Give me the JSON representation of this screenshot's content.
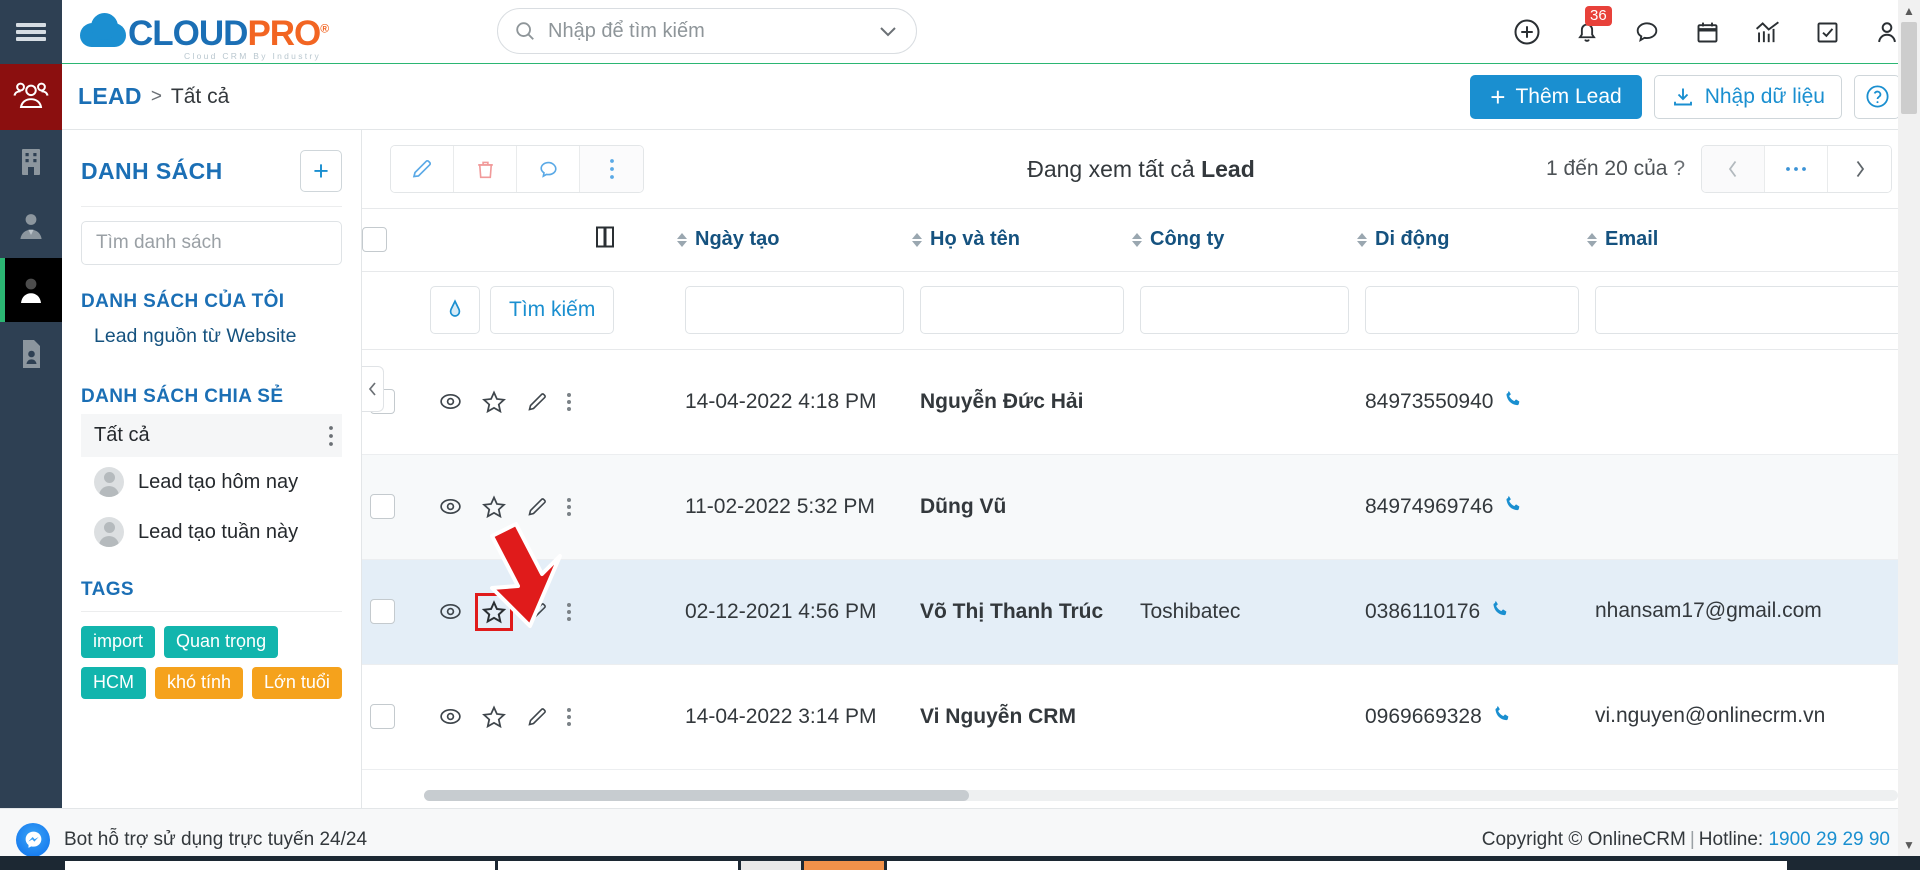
{
  "topbar": {
    "menu_icon": "hamburger-icon",
    "logo": {
      "part1": "CLOUD",
      "part2": "PRO",
      "registered": "®",
      "tagline": "Cloud CRM By Industry"
    },
    "search": {
      "placeholder": "Nhập để tìm kiếm",
      "value": "",
      "icon": "search-icon",
      "chevron": "chevron-down-icon"
    },
    "icons": [
      {
        "name": "add-circle-icon",
        "label": ""
      },
      {
        "name": "bell-icon",
        "label": "",
        "badge": "36"
      },
      {
        "name": "chat-bubble-icon",
        "label": ""
      },
      {
        "name": "calendar-icon",
        "label": ""
      },
      {
        "name": "analytics-icon",
        "label": ""
      },
      {
        "name": "task-check-icon",
        "label": ""
      },
      {
        "name": "user-account-icon",
        "label": ""
      }
    ],
    "notification_badge": "36"
  },
  "subbar": {
    "breadcrumb": {
      "root": "LEAD",
      "separator": ">",
      "current": "Tất cả"
    },
    "add_lead_label": "Thêm Lead",
    "add_lead_plus": "+",
    "import_label": "Nhập dữ liệu",
    "help_label": "?"
  },
  "rail": {
    "items": [
      {
        "name": "sidebar-item-contacts-group",
        "icon": "people-group-icon",
        "state": "active-red"
      },
      {
        "name": "sidebar-item-company",
        "icon": "building-icon",
        "state": "normal"
      },
      {
        "name": "sidebar-item-contact-person",
        "icon": "person-tie-icon",
        "state": "normal"
      },
      {
        "name": "sidebar-item-lead",
        "icon": "person-icon",
        "state": "active-black"
      },
      {
        "name": "sidebar-item-document",
        "icon": "document-person-icon",
        "state": "normal"
      }
    ]
  },
  "list_panel": {
    "title": "DANH SÁCH",
    "add_button": "+",
    "search_placeholder": "Tìm danh sách",
    "search_value": "",
    "my_lists_header": "DANH SÁCH CỦA TÔI",
    "my_lists": [
      "Lead nguồn từ Website"
    ],
    "shared_header": "DANH SÁCH CHIA SẺ",
    "shared_selected": "Tất cả",
    "shared_items": [
      {
        "label": "Lead tạo hôm nay",
        "icon": "avatar-icon"
      },
      {
        "label": "Lead tạo tuần này",
        "icon": "avatar-icon"
      }
    ],
    "tags_header": "TAGS",
    "tags": [
      {
        "label": "import",
        "color": "#12b5ad"
      },
      {
        "label": "Quan trọng",
        "color": "#12b5ad"
      },
      {
        "label": "HCM",
        "color": "#12b5ad"
      },
      {
        "label": "khó tính",
        "color": "#f5a21c"
      },
      {
        "label": "Lớn tuổi",
        "color": "#f5a21c"
      }
    ],
    "collapse_icon": "chevron-left-icon"
  },
  "main": {
    "toolbar": [
      {
        "name": "edit-button",
        "icon": "pencil-icon",
        "color": "#5aa9e6"
      },
      {
        "name": "delete-button",
        "icon": "trash-icon",
        "color": "#f19a9a"
      },
      {
        "name": "comment-button",
        "icon": "comment-icon",
        "color": "#5aa9e6"
      },
      {
        "name": "more-actions-button",
        "icon": "kebab-menu-icon",
        "color": "#5aa9e6"
      }
    ],
    "view_title_prefix": "Đang xem tất cả ",
    "view_title_strong": "Lead",
    "pagination": {
      "text": "1 đến 20 của",
      "total": "?",
      "prev_icon": "chevron-left-icon",
      "more_icon": "ellipsis-icon",
      "next_icon": "chevron-right-icon"
    },
    "columns": [
      {
        "key": "checkbox",
        "label": "",
        "sortable": false
      },
      {
        "key": "actions",
        "label": "",
        "sortable": false
      },
      {
        "key": "layout",
        "label": "",
        "icon": "column-layout-icon",
        "sortable": false
      },
      {
        "key": "created",
        "label": "Ngày tạo",
        "sortable": true
      },
      {
        "key": "name",
        "label": "Họ và tên",
        "sortable": true
      },
      {
        "key": "company",
        "label": "Công ty",
        "sortable": true
      },
      {
        "key": "mobile",
        "label": "Di động",
        "sortable": true
      },
      {
        "key": "email",
        "label": "Email",
        "sortable": true
      }
    ],
    "filter_row": {
      "erase_icon": "eraser-icon",
      "search_button": "Tìm kiếm",
      "inputs": [
        "",
        "",
        "",
        "",
        ""
      ]
    },
    "rows": [
      {
        "created": "14-04-2022 4:18 PM",
        "name": "Nguyễn Đức Hải",
        "company": "",
        "mobile": "84973550940",
        "email": "",
        "starred": false,
        "highlight": false
      },
      {
        "created": "11-02-2022 5:32 PM",
        "name": "Dũng Vũ",
        "company": "",
        "mobile": "84974969746",
        "email": "",
        "starred": false,
        "highlight": false
      },
      {
        "created": "02-12-2021 4:56 PM",
        "name": "Võ Thị Thanh Trúc",
        "company": "Toshibatec",
        "mobile": "0386110176",
        "email": "nhansam17@gmail.com",
        "starred": false,
        "highlight": true
      },
      {
        "created": "14-04-2022 3:14 PM",
        "name": "Vi Nguyễn CRM",
        "company": "",
        "mobile": "0969669328",
        "email": "vi.nguyen@onlinecrm.vn",
        "starred": false,
        "highlight": false
      }
    ],
    "row_icons": [
      {
        "name": "view-icon"
      },
      {
        "name": "star-icon"
      },
      {
        "name": "edit-icon"
      },
      {
        "name": "row-menu-icon"
      }
    ]
  },
  "footer": {
    "bot_text": "Bot hỗ trợ sử dụng trực tuyến 24/24",
    "bot_icon": "messenger-icon",
    "copyright": "Copyright © OnlineCRM",
    "separator": "|",
    "hotline_label": "Hotline:",
    "hotline_number": "1900 29 29 90"
  },
  "colors": {
    "brand_blue": "#1b6fb5",
    "brand_orange": "#f26522",
    "accent_blue": "#1a8fd0",
    "green_line": "#2bb673",
    "rail_dark": "#2e4053",
    "rail_red": "#8b0f0f",
    "badge_red": "#e8413a",
    "highlight_row": "#e4eef7",
    "annotation_red": "#e01b1b"
  }
}
